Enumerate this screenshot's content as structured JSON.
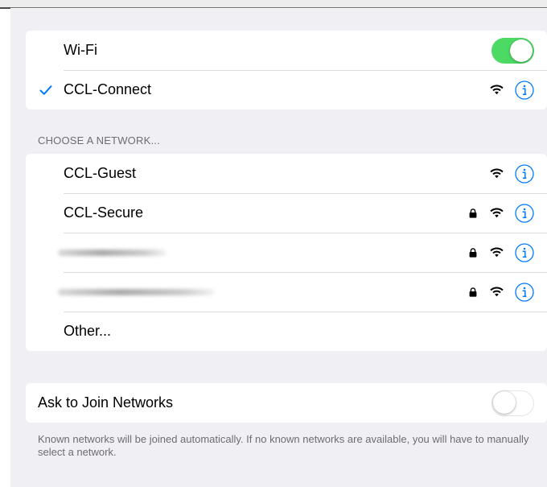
{
  "wifi_toggle": {
    "label": "Wi-Fi",
    "state": "on"
  },
  "connected_network": {
    "name": "CCL-Connect",
    "secured": false
  },
  "choose_network": {
    "header": "CHOOSE A NETWORK...",
    "networks": [
      {
        "name": "CCL-Guest",
        "secured": false
      },
      {
        "name": "CCL-Secure",
        "secured": true
      },
      {
        "name": "",
        "secured": true,
        "name_obscured": true
      },
      {
        "name": "",
        "secured": true,
        "name_obscured": true
      }
    ],
    "other_label": "Other..."
  },
  "ask_to_join": {
    "label": "Ask to Join Networks",
    "state": "off",
    "footer": "Known networks will be joined automatically. If no known networks are available, you will have to manually select a network."
  },
  "colors": {
    "accent": "#007aff",
    "toggle_on": "#4cd964",
    "background": "#efeff4",
    "secondary_text": "#6d6d72"
  },
  "icons": {
    "checkmark": "checkmark-icon",
    "wifi": "wifi-signal-icon",
    "lock": "lock-icon",
    "info": "info-icon"
  }
}
